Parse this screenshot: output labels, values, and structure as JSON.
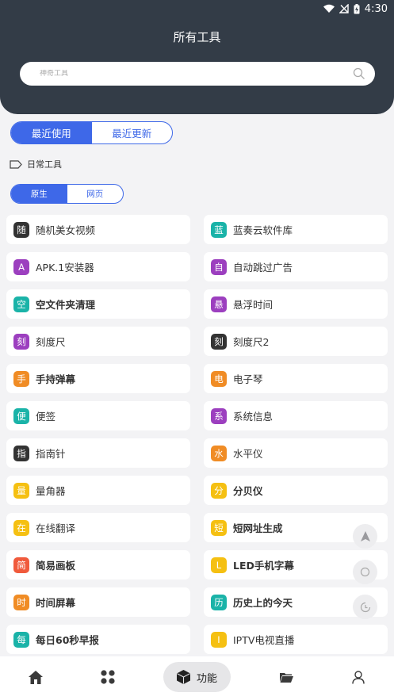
{
  "status_bar": {
    "time": "4:30"
  },
  "header": {
    "title": "所有工具"
  },
  "search": {
    "placeholder": "神奇工具"
  },
  "main_tabs": [
    {
      "label": "最近使用",
      "active": true
    },
    {
      "label": "最近更新",
      "active": false
    }
  ],
  "section": {
    "title": "日常工具"
  },
  "sub_tabs": [
    {
      "label": "原生",
      "active": true
    },
    {
      "label": "网页",
      "active": false
    }
  ],
  "tools": [
    {
      "badge": "随",
      "label": "随机美女视频",
      "color": "#333333",
      "bold": false
    },
    {
      "badge": "蓝",
      "label": "蓝奏云软件库",
      "color": "#1ab3a8",
      "bold": false
    },
    {
      "badge": "A",
      "label": "APK.1安装器",
      "color": "#9c3fbf",
      "bold": false
    },
    {
      "badge": "自",
      "label": "自动跳过广告",
      "color": "#9c3fbf",
      "bold": false
    },
    {
      "badge": "空",
      "label": "空文件夹清理",
      "color": "#1ab3a8",
      "bold": true
    },
    {
      "badge": "悬",
      "label": "悬浮时间",
      "color": "#9c3fbf",
      "bold": false
    },
    {
      "badge": "刻",
      "label": "刻度尺",
      "color": "#9c3fbf",
      "bold": false
    },
    {
      "badge": "刻",
      "label": "刻度尺2",
      "color": "#333333",
      "bold": false
    },
    {
      "badge": "手",
      "label": "手持弹幕",
      "color": "#f08c25",
      "bold": true
    },
    {
      "badge": "电",
      "label": "电子琴",
      "color": "#f08c25",
      "bold": false
    },
    {
      "badge": "便",
      "label": "便签",
      "color": "#1ab3a8",
      "bold": false
    },
    {
      "badge": "系",
      "label": "系统信息",
      "color": "#9c3fbf",
      "bold": false
    },
    {
      "badge": "指",
      "label": "指南针",
      "color": "#333333",
      "bold": false
    },
    {
      "badge": "水",
      "label": "水平仪",
      "color": "#f08c25",
      "bold": false
    },
    {
      "badge": "量",
      "label": "量角器",
      "color": "#f5c012",
      "bold": false
    },
    {
      "badge": "分",
      "label": "分贝仪",
      "color": "#f5c012",
      "bold": true
    },
    {
      "badge": "在",
      "label": "在线翻译",
      "color": "#f5c012",
      "bold": false
    },
    {
      "badge": "短",
      "label": "短网址生成",
      "color": "#f5c012",
      "bold": true
    },
    {
      "badge": "简",
      "label": "简易画板",
      "color": "#f05a3c",
      "bold": true
    },
    {
      "badge": "L",
      "label": "LED手机字幕",
      "color": "#f5c012",
      "bold": true
    },
    {
      "badge": "时",
      "label": "时间屏幕",
      "color": "#f08c25",
      "bold": true
    },
    {
      "badge": "历",
      "label": "历史上的今天",
      "color": "#1ab3a8",
      "bold": true
    },
    {
      "badge": "每",
      "label": "每日60秒早报",
      "color": "#1ab3a8",
      "bold": true
    },
    {
      "badge": "I",
      "label": "IPTV电视直播",
      "color": "#f5c012",
      "bold": false
    }
  ],
  "floating_buttons": [
    {
      "icon": "arrow-up-icon"
    },
    {
      "icon": "search-icon"
    },
    {
      "icon": "history-icon"
    }
  ],
  "bottom_nav": {
    "items": [
      {
        "icon": "home-icon"
      },
      {
        "icon": "grid-icon"
      },
      {
        "icon": "cube-icon",
        "label": "功能",
        "active": true
      },
      {
        "icon": "folder-icon"
      },
      {
        "icon": "user-icon"
      }
    ]
  },
  "colors": {
    "header_bg": "#333c47",
    "accent": "#3e68e8",
    "page_bg": "#f3f3f5"
  }
}
